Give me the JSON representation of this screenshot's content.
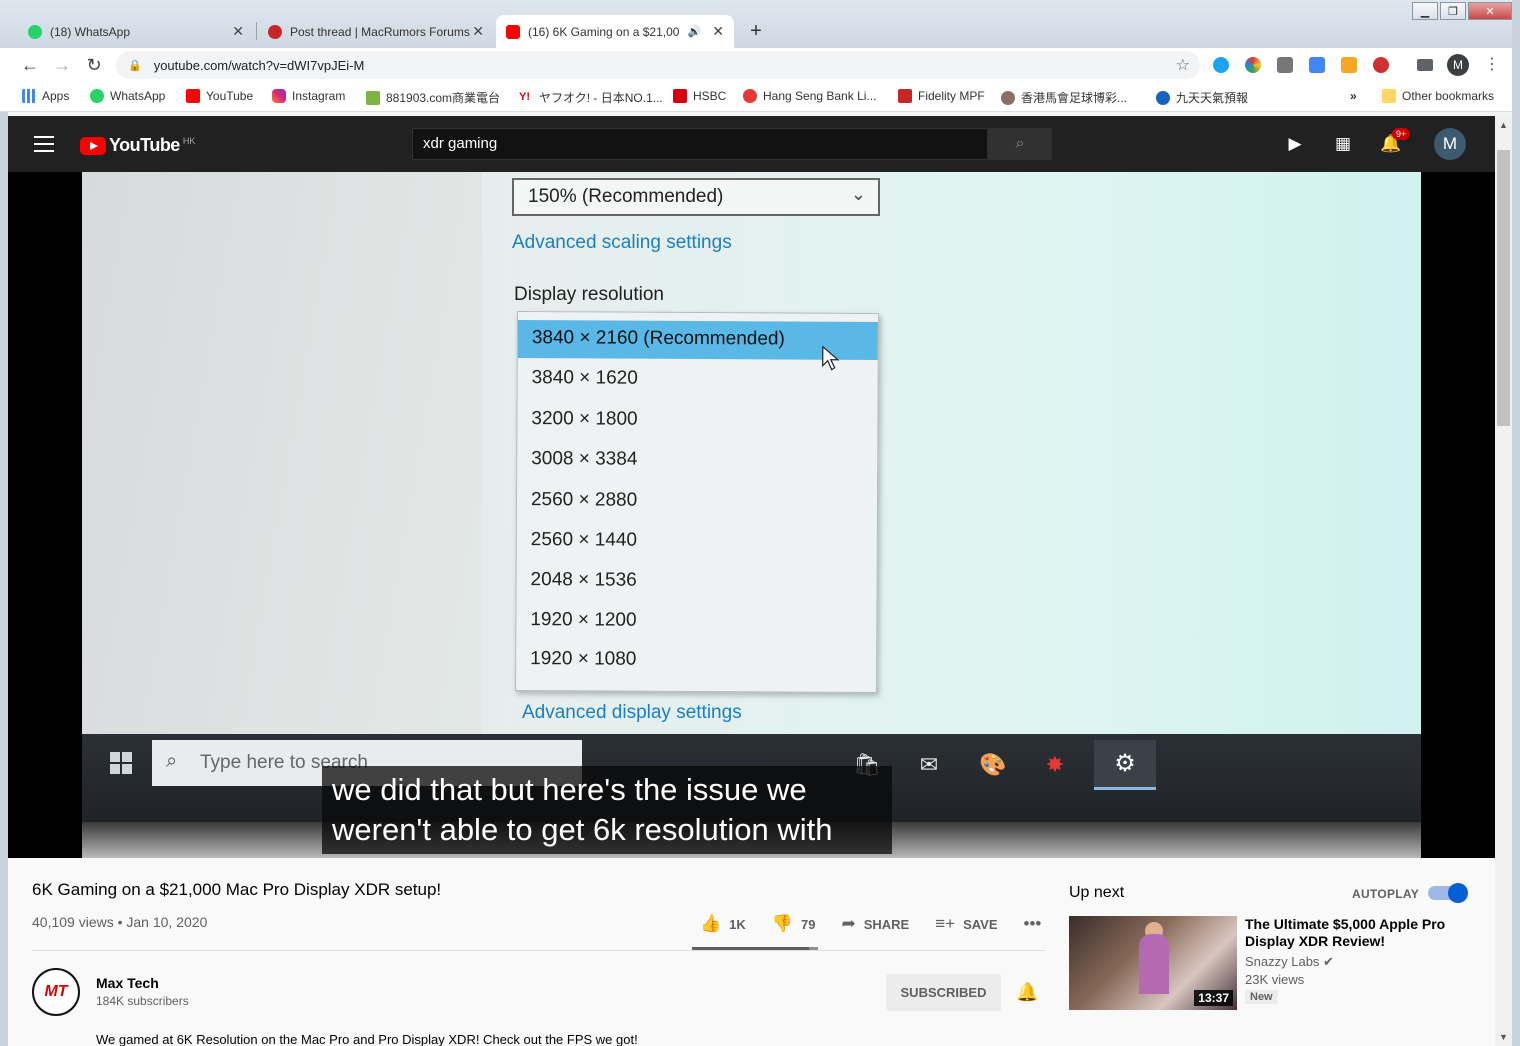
{
  "tabs": [
    {
      "label": "(18) WhatsApp",
      "icon": "whatsapp-icon",
      "active": false
    },
    {
      "label": "Post thread | MacRumors Forums",
      "icon": "macrumors-icon",
      "active": false
    },
    {
      "label": "(16) 6K Gaming on a $21,00",
      "icon": "youtube-icon",
      "active": true
    }
  ],
  "address": "youtube.com/watch?v=dWI7vpJEi-M",
  "profile_initial": "M",
  "bookmarks": [
    {
      "label": "Apps",
      "icon": "apps-grid-icon"
    },
    {
      "label": "WhatsApp",
      "icon": "whatsapp-icon"
    },
    {
      "label": "YouTube",
      "icon": "youtube-icon"
    },
    {
      "label": "Instagram",
      "icon": "instagram-icon"
    },
    {
      "label": "881903.com商業電台",
      "icon": "radio-icon"
    },
    {
      "label": "ヤフオク! - 日本NO.1...",
      "icon": "yahoo-icon"
    },
    {
      "label": "HSBC",
      "icon": "hsbc-icon"
    },
    {
      "label": "Hang Seng Bank Li...",
      "icon": "hangseng-icon"
    },
    {
      "label": "Fidelity MPF",
      "icon": "fidelity-icon"
    },
    {
      "label": "香港馬會足球博彩...",
      "icon": "jockey-club-icon"
    },
    {
      "label": "九天天氣預報",
      "icon": "weather-icon"
    }
  ],
  "other_bookmarks": "Other bookmarks",
  "youtube": {
    "logo_text": "YouTube",
    "region": "HK",
    "search_query": "xdr gaming",
    "notif_badge": "9+",
    "avatar_initial": "M"
  },
  "video_frame": {
    "scale_value": "150% (Recommended)",
    "advanced_scaling": "Advanced scaling settings",
    "display_resolution_label": "Display resolution",
    "resolutions": [
      "3840 × 2160 (Recommended)",
      "3840 × 1620",
      "3200 × 1800",
      "3008 × 3384",
      "2560 × 2880",
      "2560 × 1440",
      "2048 × 1536",
      "1920 × 1200",
      "1920 × 1080"
    ],
    "advanced_display": "Advanced display settings",
    "taskbar_search": "Type here to search"
  },
  "caption": {
    "line1": "we did that but here's the issue we",
    "line2": "weren't able to get 6k resolution with"
  },
  "video": {
    "title": "6K Gaming on a $21,000 Mac Pro Display XDR setup!",
    "views_date": "40,109 views • Jan 10, 2020",
    "likes": "1K",
    "dislikes": "79",
    "like_ratio": 0.93,
    "share": "SHARE",
    "save": "SAVE",
    "description": "We gamed at 6K Resolution on the Mac Pro and Pro Display XDR! Check out the FPS we got!"
  },
  "channel": {
    "name": "Max Tech",
    "subscribers": "184K subscribers",
    "subscribe_label": "SUBSCRIBED",
    "avatar_text": "MT"
  },
  "upnext": {
    "heading": "Up next",
    "autoplay": "AUTOPLAY",
    "item": {
      "title": "The Ultimate $5,000 Apple Pro Display XDR Review!",
      "channel": "Snazzy Labs ✔",
      "views": "23K views",
      "badge": "New",
      "duration": "13:37"
    }
  }
}
